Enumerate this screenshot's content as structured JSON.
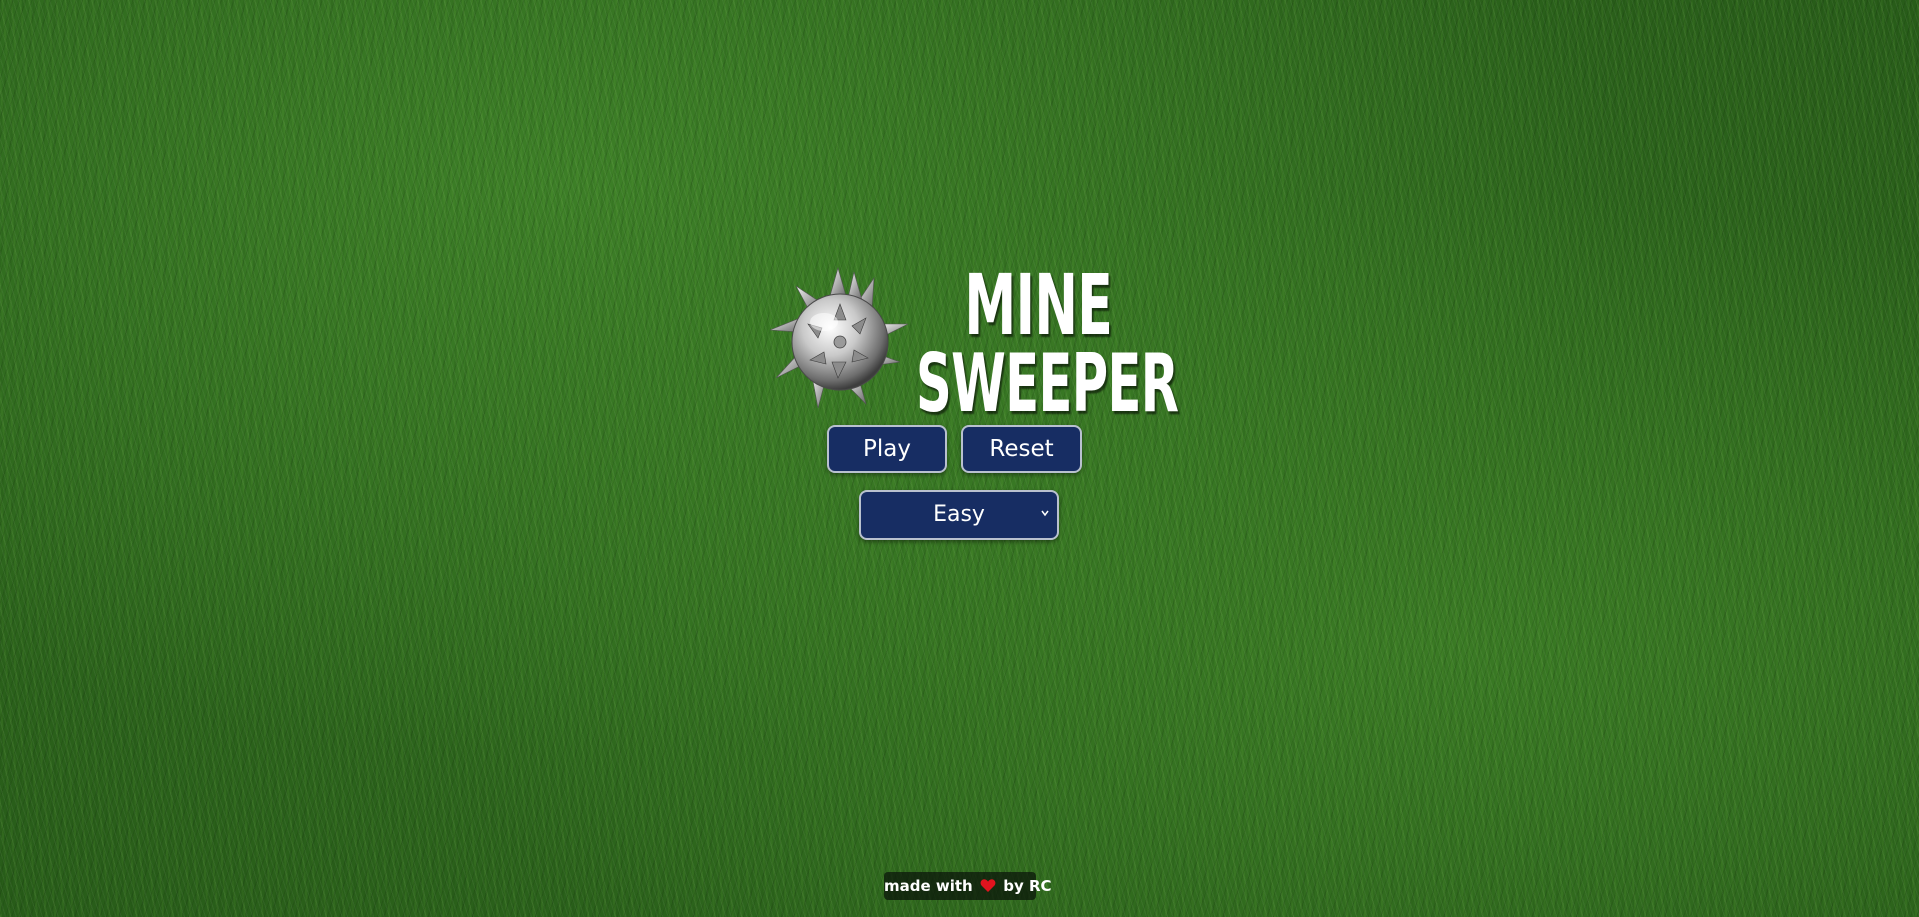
{
  "logo": {
    "title_line1": "MINE",
    "title_line2": "SWEEPER",
    "icon": "spiked-mine-icon"
  },
  "controls": {
    "play_label": "Play",
    "reset_label": "Reset",
    "difficulty": {
      "selected": "Easy",
      "icon": "chevron-down-icon"
    }
  },
  "footer": {
    "prefix": "made with",
    "icon": "heart-icon",
    "suffix": "by RC"
  },
  "colors": {
    "button_bg": "#172d63",
    "button_border": "#b9c1cf",
    "grass": "#2f6a1e",
    "heart": "#e0141e"
  }
}
